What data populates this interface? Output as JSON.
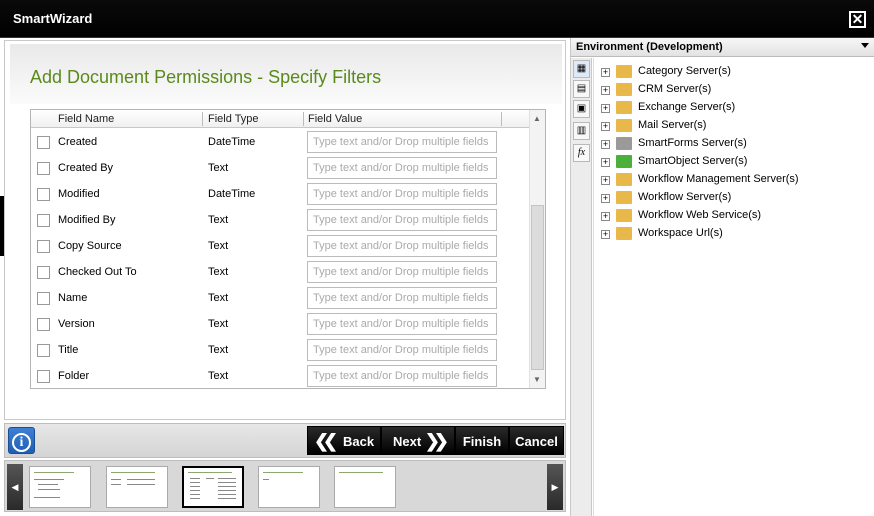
{
  "window": {
    "title": "SmartWizard",
    "close_icon": "close-icon"
  },
  "page": {
    "heading": "Add Document Permissions - Specify Filters"
  },
  "grid": {
    "columns": [
      "Field Name",
      "Field Type",
      "Field Value"
    ],
    "placeholder": "Type text and/or Drop multiple fields",
    "rows": [
      {
        "name": "Created",
        "type": "DateTime"
      },
      {
        "name": "Created By",
        "type": "Text"
      },
      {
        "name": "Modified",
        "type": "DateTime"
      },
      {
        "name": "Modified By",
        "type": "Text"
      },
      {
        "name": "Copy Source",
        "type": "Text"
      },
      {
        "name": "Checked Out To",
        "type": "Text"
      },
      {
        "name": "Name",
        "type": "Text"
      },
      {
        "name": "Version",
        "type": "Text"
      },
      {
        "name": "Title",
        "type": "Text"
      },
      {
        "name": "Folder",
        "type": "Text"
      }
    ]
  },
  "toolbar": {
    "info_icon": "info-icon",
    "back_label": "Back",
    "next_label": "Next",
    "finish_label": "Finish",
    "cancel_label": "Cancel"
  },
  "environment": {
    "label": "Environment (Development)",
    "tree": [
      {
        "label": "Category Server(s)",
        "icon_color": "#e8b84a"
      },
      {
        "label": "CRM Server(s)",
        "icon_color": "#e8b84a"
      },
      {
        "label": "Exchange Server(s)",
        "icon_color": "#e8b84a"
      },
      {
        "label": "Mail Server(s)",
        "icon_color": "#e8b84a"
      },
      {
        "label": "SmartForms Server(s)",
        "icon_color": "#9a9a9a"
      },
      {
        "label": "SmartObject Server(s)",
        "icon_color": "#4caf3a"
      },
      {
        "label": "Workflow Management Server(s)",
        "icon_color": "#e8b84a"
      },
      {
        "label": "Workflow Server(s)",
        "icon_color": "#e8b84a"
      },
      {
        "label": "Workflow Web Service(s)",
        "icon_color": "#e8b84a"
      },
      {
        "label": "Workspace Url(s)",
        "icon_color": "#e8b84a"
      }
    ]
  },
  "colors": {
    "accent": "#5a8a1b",
    "titlebar": "#000000",
    "info": "#2a6cc4"
  }
}
